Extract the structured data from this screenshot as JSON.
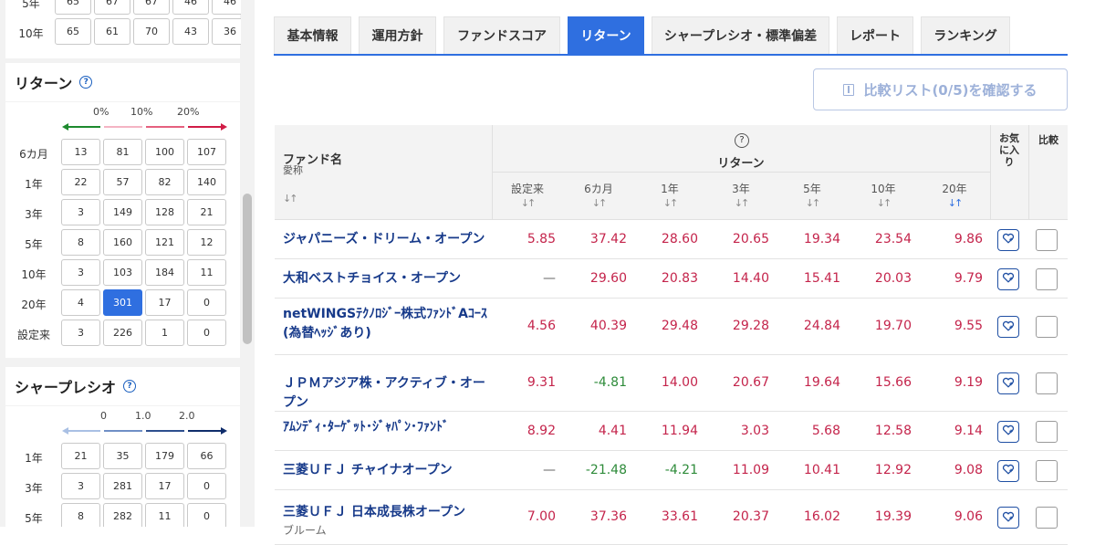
{
  "sidebar": {
    "top_rows": [
      {
        "label": "5年",
        "cells": [
          "65",
          "67",
          "67",
          "46",
          "46"
        ]
      },
      {
        "label": "10年",
        "cells": [
          "65",
          "61",
          "70",
          "43",
          "36"
        ]
      }
    ],
    "return_section": {
      "title": "リターン",
      "help": "?",
      "scale": [
        "0%",
        "10%",
        "20%"
      ],
      "rows": [
        {
          "label": "6カ月",
          "cells": [
            "13",
            "81",
            "100",
            "107"
          ]
        },
        {
          "label": "1年",
          "cells": [
            "22",
            "57",
            "82",
            "140"
          ]
        },
        {
          "label": "3年",
          "cells": [
            "3",
            "149",
            "128",
            "21"
          ]
        },
        {
          "label": "5年",
          "cells": [
            "8",
            "160",
            "121",
            "12"
          ]
        },
        {
          "label": "10年",
          "cells": [
            "3",
            "103",
            "184",
            "11"
          ]
        },
        {
          "label": "20年",
          "cells": [
            "4",
            "301",
            "17",
            "0"
          ]
        },
        {
          "label": "設定来",
          "cells": [
            "3",
            "226",
            "1",
            "0"
          ]
        }
      ]
    },
    "sharpe_section": {
      "title": "シャープレシオ",
      "help": "?",
      "scale": [
        "0",
        "1.0",
        "2.0"
      ],
      "rows": [
        {
          "label": "1年",
          "cells": [
            "21",
            "35",
            "179",
            "66"
          ]
        },
        {
          "label": "3年",
          "cells": [
            "3",
            "281",
            "17",
            "0"
          ]
        },
        {
          "label": "5年",
          "cells": [
            "8",
            "282",
            "11",
            "0"
          ]
        }
      ]
    }
  },
  "tabs": [
    "基本情報",
    "運用方針",
    "ファンドスコア",
    "リターン",
    "シャープレシオ・標準偏差",
    "レポート",
    "ランキング"
  ],
  "active_tab": "リターン",
  "compare_button": "比較リスト(0/5)を確認する",
  "table": {
    "header": {
      "fund_name": "ファンド名",
      "nickname": "愛称",
      "help": "?",
      "return_group": "リターン",
      "columns": [
        "設定来",
        "6カ月",
        "1年",
        "3年",
        "5年",
        "10年",
        "20年"
      ],
      "sort_icon": "↓↑",
      "favorite": "お気に入り",
      "compare": "比較"
    },
    "rows": [
      {
        "name": "ジャパニーズ・ドリーム・オープン",
        "nickname": "",
        "values": [
          "5.85",
          "37.42",
          "28.60",
          "20.65",
          "19.34",
          "23.54",
          "9.86"
        ]
      },
      {
        "name": "大和ベストチョイス・オープン",
        "nickname": "",
        "values": [
          "—",
          "29.60",
          "20.83",
          "14.40",
          "15.41",
          "20.03",
          "9.79"
        ]
      },
      {
        "name": "netWINGSﾃｸﾉﾛｼﾞｰ株式ﾌｧﾝﾄﾞAｺｰｽ(為替ﾍｯｼﾞあり)",
        "nickname": "",
        "values": [
          "4.56",
          "40.39",
          "29.48",
          "29.28",
          "24.84",
          "19.70",
          "9.55"
        ]
      },
      {
        "name": "ＪＰＭアジア株・アクティブ・オープン",
        "nickname": "",
        "values": [
          "9.31",
          "-4.81",
          "14.00",
          "20.67",
          "19.64",
          "15.66",
          "9.19"
        ]
      },
      {
        "name": "ｱﾑﾝﾃﾞｨ･ﾀｰｹﾞｯﾄ･ｼﾞｬﾊﾟﾝ･ﾌｧﾝﾄﾞ",
        "nickname": "",
        "values": [
          "8.92",
          "4.41",
          "11.94",
          "3.03",
          "5.68",
          "12.58",
          "9.14"
        ]
      },
      {
        "name": "三菱ＵＦＪ チャイナオープン",
        "nickname": "",
        "values": [
          "—",
          "-21.48",
          "-4.21",
          "11.09",
          "10.41",
          "12.92",
          "9.08"
        ]
      },
      {
        "name": "三菱ＵＦＪ 日本成長株オープン",
        "nickname": "ブルーム",
        "values": [
          "7.00",
          "37.36",
          "33.61",
          "20.37",
          "16.02",
          "19.39",
          "9.06"
        ]
      }
    ]
  },
  "colors": {
    "accent": "#2f6fe0",
    "positive": "#c4244b",
    "negative": "#2e8b3a",
    "link": "#173a8a"
  }
}
